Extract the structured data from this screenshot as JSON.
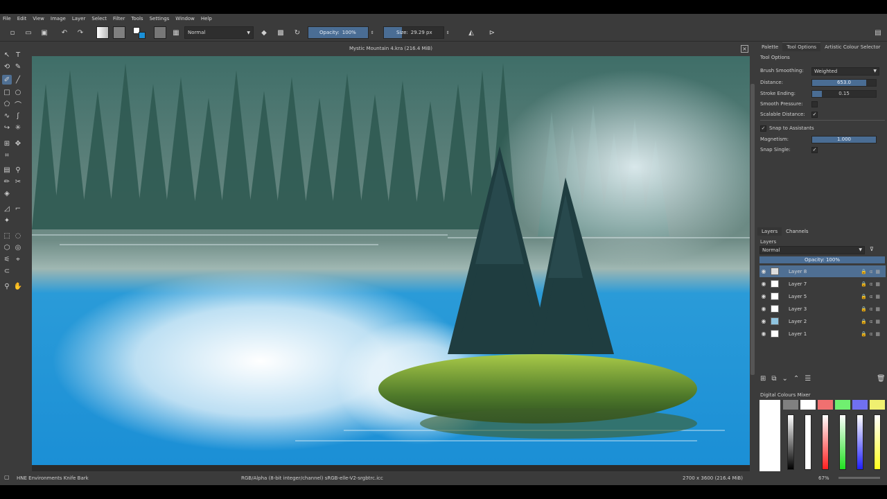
{
  "menu": [
    "File",
    "Edit",
    "View",
    "Image",
    "Layer",
    "Select",
    "Filter",
    "Tools",
    "Settings",
    "Window",
    "Help"
  ],
  "toolbar": {
    "blend_mode": "Normal",
    "opacity_label": "Opacity:",
    "opacity_value": "100%",
    "size_label": "Size:",
    "size_value": "29.29 px"
  },
  "document": {
    "title": "Mystic Mountain 4.kra (216.4 MiB)"
  },
  "dock_tabs": [
    "Palette",
    "Tool Options",
    "Artistic Colour Selector"
  ],
  "tool_options": {
    "header": "Tool Options",
    "brush_smoothing_label": "Brush Smoothing:",
    "brush_smoothing_value": "Weighted",
    "distance_label": "Distance:",
    "distance_value": "653.0",
    "distance_fraction": 0.85,
    "stroke_ending_label": "Stroke Ending:",
    "stroke_ending_value": "0.15",
    "stroke_ending_fraction": 0.15,
    "smooth_pressure_label": "Smooth Pressure:",
    "smooth_pressure_checked": false,
    "scalable_distance_label": "Scalable Distance:",
    "scalable_distance_checked": true,
    "snap_assistants_label": "Snap to Assistants",
    "snap_assistants_checked": true,
    "magnetism_label": "Magnetism:",
    "magnetism_value": "1.000",
    "magnetism_fraction": 1.0,
    "snap_single_label": "Snap Single:",
    "snap_single_checked": true
  },
  "layers_tabs": [
    "Layers",
    "Channels"
  ],
  "layers": {
    "header": "Layers",
    "blend_mode": "Normal",
    "opacity_label": "Opacity:  100%",
    "items": [
      {
        "name": "Layer 8",
        "selected": true
      },
      {
        "name": "Layer 7",
        "selected": false
      },
      {
        "name": "Layer 5",
        "selected": false
      },
      {
        "name": "Layer 3",
        "selected": false
      },
      {
        "name": "Layer 2",
        "selected": false
      },
      {
        "name": "Layer 1",
        "selected": false
      }
    ]
  },
  "mixer": {
    "header": "Digital Colours Mixer",
    "swatches": [
      "#808080",
      "#ffffff",
      "#f07070",
      "#70f070",
      "#7070f0",
      "#f0f070"
    ],
    "bars": [
      "#000000",
      "#ffffff",
      "#ff2020",
      "#20e020",
      "#2020ff",
      "#ffff20"
    ]
  },
  "status": {
    "brush": "HNE Environments Knife Bark",
    "color_profile": "RGB/Alpha (8-bit integer/channel)  sRGB-elle-V2-srgbtrc.icc",
    "image_size": "2700 x 3600 (216.4 MiB)",
    "zoom": "67%"
  },
  "colors": {
    "accent": "#4f6f93",
    "panel": "#3b3b3b"
  }
}
